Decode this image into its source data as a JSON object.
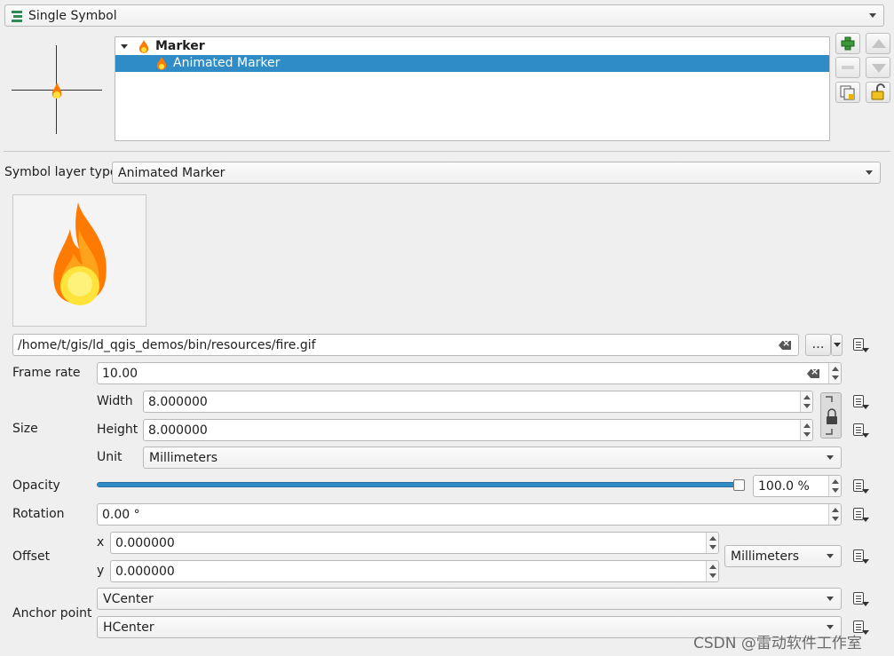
{
  "renderer": {
    "label": "Single Symbol"
  },
  "tree": {
    "parent": {
      "label": "Marker"
    },
    "child": {
      "label": "Animated Marker"
    }
  },
  "symbol_layer_type": {
    "label": "Symbol layer type",
    "value": "Animated Marker"
  },
  "file": {
    "path": "/home/t/gis/ld_qgis_demos/bin/resources/fire.gif",
    "browse_label": "…"
  },
  "frame_rate": {
    "label": "Frame rate",
    "value": "10.00"
  },
  "size": {
    "label": "Size",
    "width_label": "Width",
    "width_value": "8.000000",
    "height_label": "Height",
    "height_value": "8.000000",
    "unit_label": "Unit",
    "unit_value": "Millimeters"
  },
  "opacity": {
    "label": "Opacity",
    "value": "100.0 %",
    "level": 1.0
  },
  "rotation": {
    "label": "Rotation",
    "value": "0.00 °"
  },
  "offset": {
    "label": "Offset",
    "x_label": "x",
    "x_value": "0.000000",
    "y_label": "y",
    "y_value": "0.000000",
    "unit_value": "Millimeters"
  },
  "anchor": {
    "label": "Anchor point",
    "vertical": "VCenter",
    "horizontal": "HCenter"
  },
  "watermark": "CSDN @雷动软件工作室",
  "colors": {
    "selection": "#308cc6",
    "flame_outer": "#ff7a00",
    "flame_core": "#ffe33a"
  }
}
